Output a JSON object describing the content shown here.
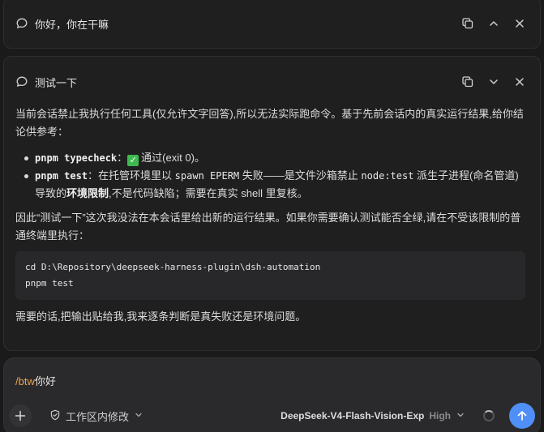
{
  "thread1": {
    "title": "你好，你在干嘛"
  },
  "thread2": {
    "title": "测试一下",
    "intro": "当前会话禁止我执行任何工具(仅允许文字回答),所以无法实际跑命令。基于先前会话内的真实运行结果,给你结论供参考：",
    "bullets": [
      {
        "code": "pnpm typecheck",
        "sep": "：",
        "check": "✓",
        "text": "通过(exit 0)。"
      },
      {
        "code": "pnpm test",
        "sep": "：",
        "text_a": "在托管环境里以 ",
        "code2": "spawn EPERM",
        "text_b": " 失败——是文件沙箱禁止 ",
        "code3": "node:test",
        "text_c": " 派生子进程(命名管道)导致的",
        "bold": "环境限制",
        "text_d": ",不是代码缺陷；需要在真实 shell 里复核。"
      }
    ],
    "para2": "因此“测试一下”这次我没法在本会话里给出新的运行结果。如果你需要确认测试能否全绿,请在不受该限制的普通终端里执行：",
    "code_lines": [
      "cd D:\\Repository\\deepseek-harness-plugin\\dsh-automation",
      "pnpm test"
    ],
    "outro": "需要的话,把输出贴给我,我来逐条判断是真失败还是环境问题。"
  },
  "composer": {
    "command": "/btw",
    "text": "你好",
    "scope_label": "工作区内修改",
    "model_name": "DeepSeek-V4-Flash-Vision-Exp",
    "model_level": "High"
  }
}
